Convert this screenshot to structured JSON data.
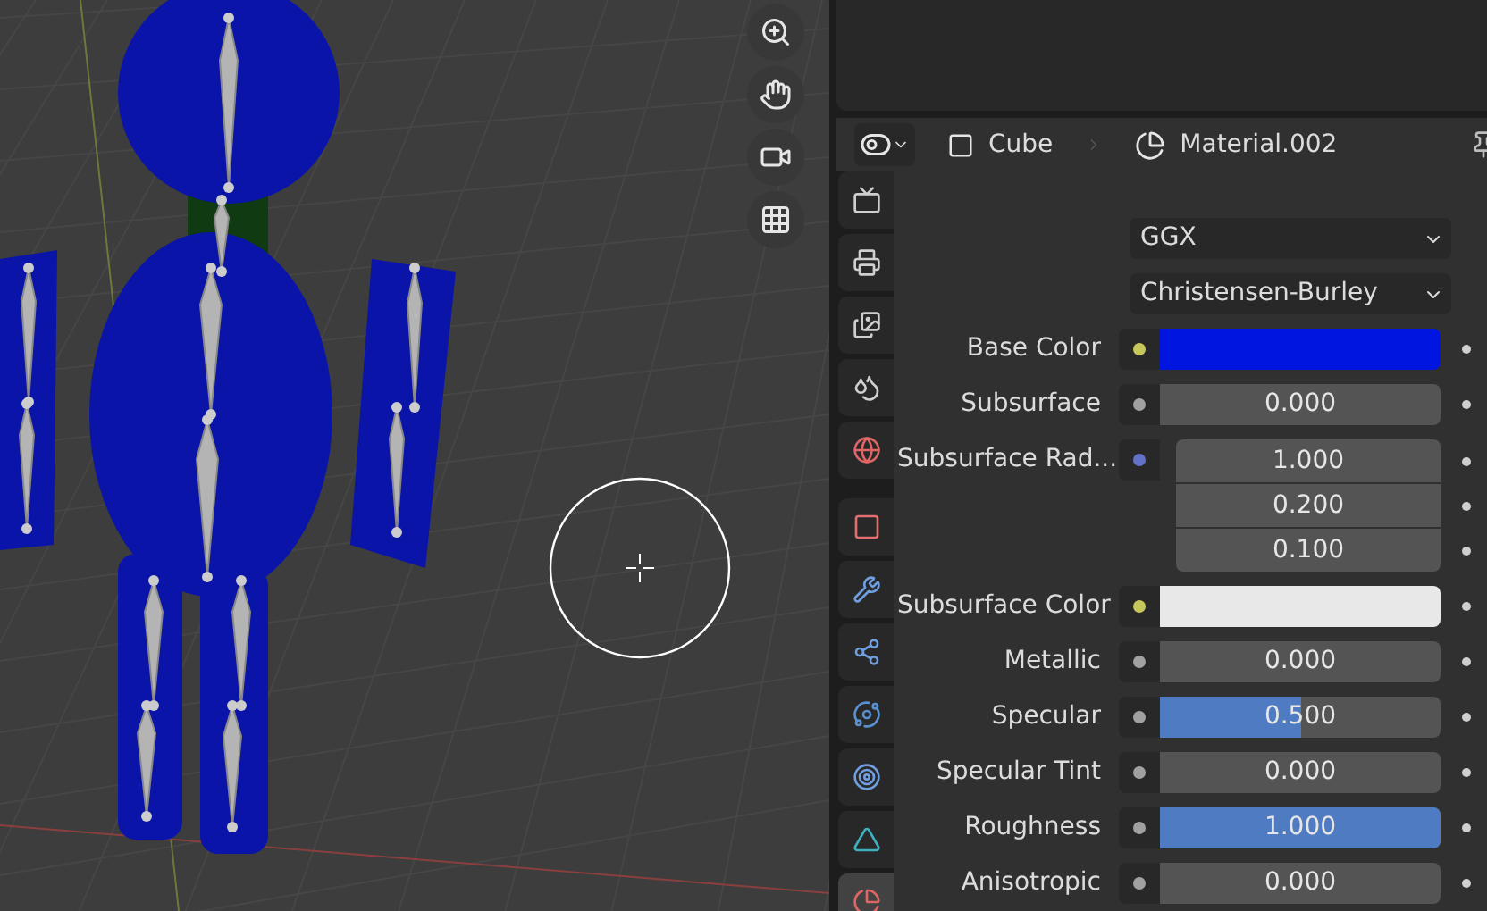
{
  "viewport": {
    "nav_buttons": [
      {
        "kind": "zoom"
      },
      {
        "kind": "pan"
      },
      {
        "kind": "camera"
      },
      {
        "kind": "ortho"
      }
    ]
  },
  "properties": {
    "header": {
      "object": "Cube",
      "material": "Material.002"
    },
    "tabs": [
      {
        "kind": "render",
        "selected": false
      },
      {
        "kind": "output",
        "selected": false
      },
      {
        "kind": "view_layer",
        "selected": false
      },
      {
        "kind": "scene",
        "selected": false
      },
      {
        "kind": "world",
        "selected": false
      },
      {
        "kind": "object",
        "selected": false
      },
      {
        "kind": "modifiers",
        "selected": false
      },
      {
        "kind": "particles",
        "selected": false
      },
      {
        "kind": "physics",
        "selected": false
      },
      {
        "kind": "constraints",
        "selected": false
      },
      {
        "kind": "data",
        "selected": false
      },
      {
        "kind": "material",
        "selected": true
      }
    ],
    "dropdowns": [
      {
        "value": "GGX"
      },
      {
        "value": "Christensen-Burley"
      }
    ],
    "rows": [
      {
        "kind": "color",
        "label": "Base Color",
        "color": "#0015e0"
      },
      {
        "kind": "slider",
        "label": "Subsurface",
        "value": "0.000",
        "level": 0
      },
      {
        "kind": "vector",
        "label": "Subsurface Rad...",
        "values": [
          "1.000",
          "0.200",
          "0.100"
        ]
      },
      {
        "kind": "color",
        "label": "Subsurface Color",
        "color": "#e8e8e8"
      },
      {
        "kind": "slider",
        "label": "Metallic",
        "value": "0.000",
        "level": 0
      },
      {
        "kind": "slider",
        "label": "Specular",
        "value": "0.500",
        "level": 0.5
      },
      {
        "kind": "slider",
        "label": "Specular Tint",
        "value": "0.000",
        "level": 0
      },
      {
        "kind": "slider",
        "label": "Roughness",
        "value": "1.000",
        "level": 1
      },
      {
        "kind": "slider",
        "label": "Anisotropic",
        "value": "0.000",
        "level": 0
      }
    ]
  }
}
